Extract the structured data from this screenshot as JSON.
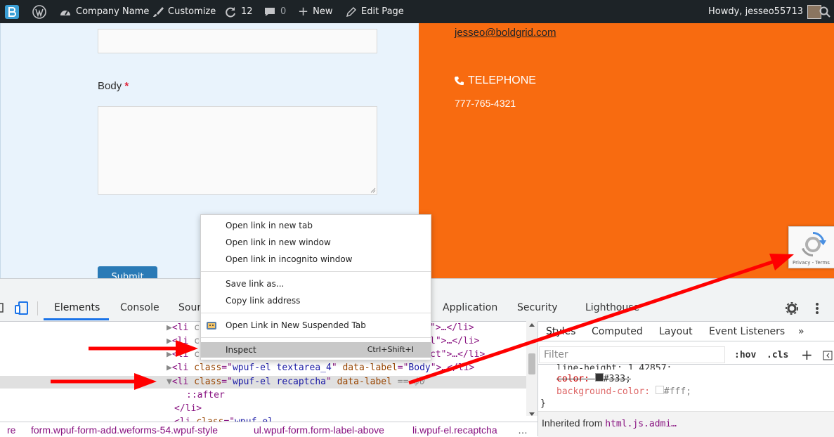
{
  "admin_bar": {
    "site_name": "Company Name",
    "customize": "Customize",
    "updates_count": "12",
    "comments_count": "0",
    "new_label": "New",
    "edit_page": "Edit Page",
    "howdy": "Howdy, jesseo55713"
  },
  "form": {
    "body_label": "Body",
    "required_mark": "*",
    "submit_label": "Submit"
  },
  "contact": {
    "email": "jesseo@boldgrid.com",
    "telephone_heading": "TELEPHONE",
    "telephone_number": "777-765-4321"
  },
  "recaptcha": {
    "links": "Privacy - Terms"
  },
  "devtools": {
    "tabs": [
      "Elements",
      "Console",
      "Sour",
      "Application",
      "Security",
      "Lighthouse"
    ],
    "dom_lines": {
      "line1_tail": "\">…</li>",
      "line2_tail": "l\">…</li>",
      "line3_tail": "ct\">…</li>",
      "line4_class": "wpuf-el textarea_4",
      "line4_label": "Body",
      "line5_class": "wpuf-el recaptcha",
      "line5_tail": "== $0",
      "after": "::after",
      "close_li": "</li>"
    },
    "breadcrumbs": [
      "re",
      "form.wpuf-form-add.weforms-54.wpuf-style",
      "ul.wpuf-form.form-label-above",
      "li.wpuf-el.recaptcha"
    ],
    "styles_tabs": [
      "Styles",
      "Computed",
      "Layout",
      "Event Listeners"
    ],
    "filter_placeholder": "Filter",
    "hov": ":hov",
    "cls": ".cls",
    "css": {
      "line_height": "line-height: 1.42857;",
      "color_prop": "color:",
      "color_val": "#333;",
      "bg_prop": "background-color:",
      "bg_val": "#fff;",
      "close": "}"
    },
    "inherited": "Inherited from",
    "inherited_sel": "html.js.admi…"
  },
  "context_menu": {
    "items": [
      {
        "label": "Open link in new tab"
      },
      {
        "label": "Open link in new window"
      },
      {
        "label": "Open link in incognito window"
      },
      {
        "label": "Save link as..."
      },
      {
        "label": "Copy link address"
      },
      {
        "label": "Open Link in New Suspended Tab"
      },
      {
        "label": "Inspect",
        "shortcut": "Ctrl+Shift+I"
      }
    ]
  },
  "colors": {
    "admin_bar": "#1d2327",
    "accent_orange": "#f86b10",
    "form_bg": "#e9f3fc",
    "annotation_red": "#ff0000"
  }
}
